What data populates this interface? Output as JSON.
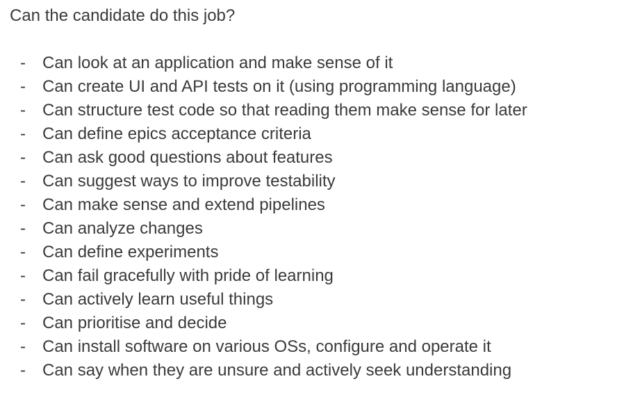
{
  "document": {
    "heading": "Can the candidate do this job?",
    "bullet": "-",
    "items": [
      "Can look at an application and make sense of it",
      "Can create UI and API tests on it (using programming language)",
      "Can structure test code so that reading them make sense for later",
      "Can define epics acceptance criteria",
      "Can ask good questions about features",
      "Can suggest ways to improve testability",
      "Can make sense and extend pipelines",
      "Can analyze changes",
      "Can define experiments",
      "Can fail gracefully with pride of learning",
      "Can actively learn useful things",
      "Can prioritise and decide",
      "Can install software on various OSs, configure and operate it",
      "Can say when they are unsure and actively seek understanding"
    ]
  }
}
